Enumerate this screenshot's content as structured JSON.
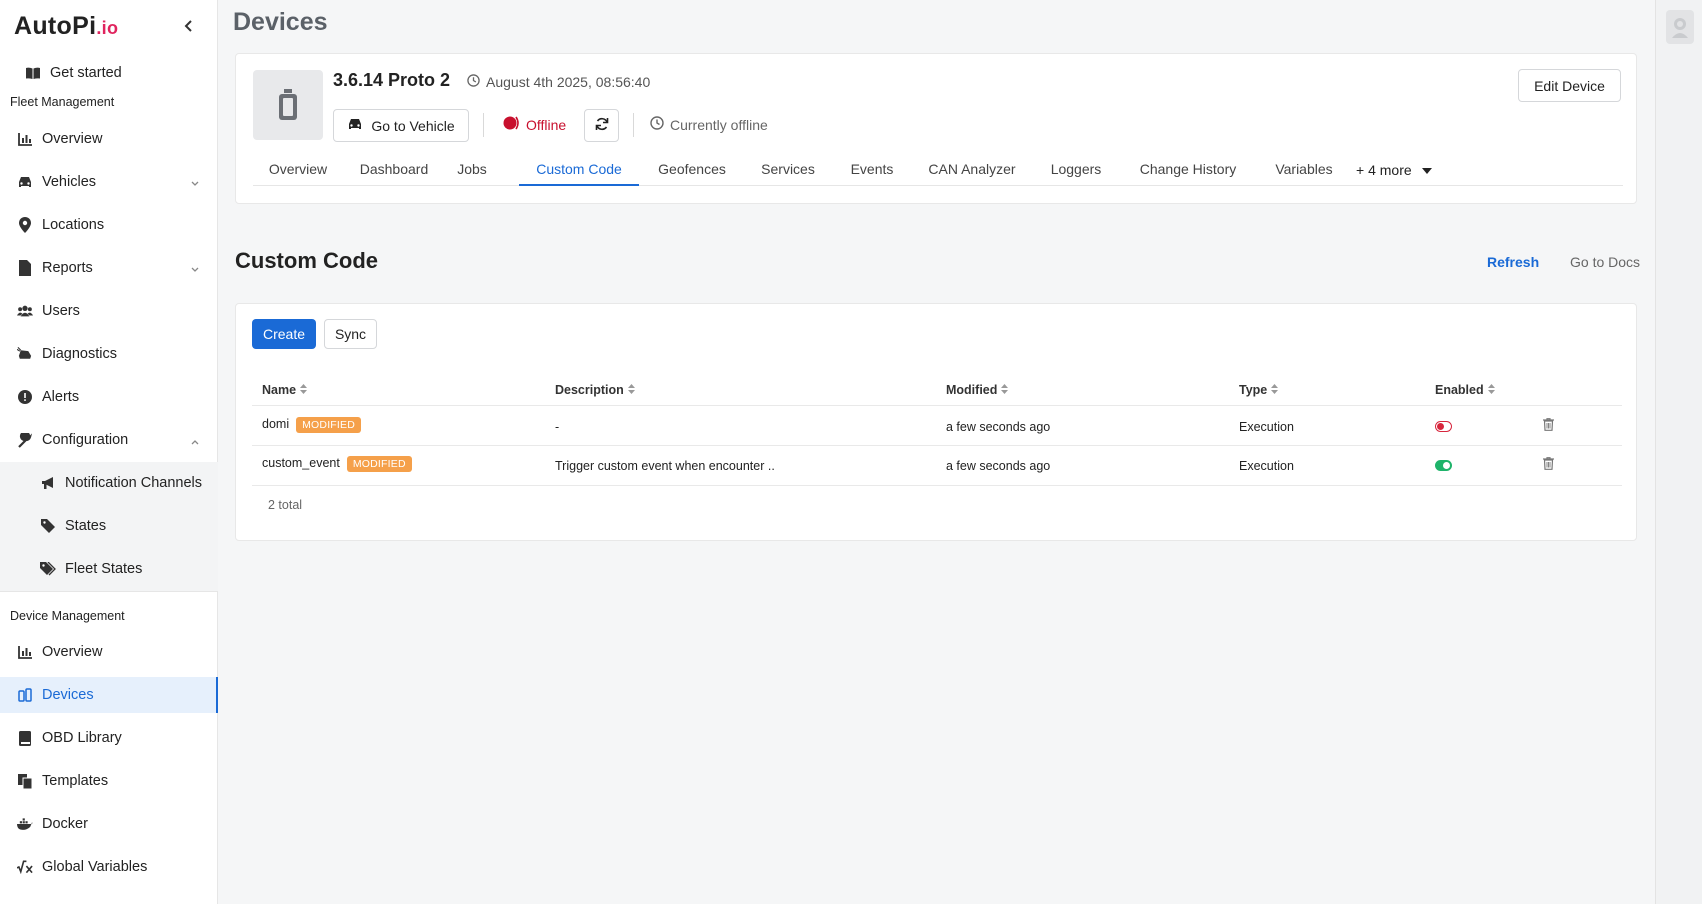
{
  "brand": {
    "logo_main": "AutoPi",
    "logo_suffix": ".io"
  },
  "sidebar": {
    "get_started": "Get started",
    "fleet_section": "Fleet Management",
    "fleet_items": {
      "overview": "Overview",
      "vehicles": "Vehicles",
      "locations": "Locations",
      "reports": "Reports",
      "users": "Users",
      "diagnostics": "Diagnostics",
      "alerts": "Alerts",
      "configuration": "Configuration",
      "notification_channels": "Notification Channels",
      "states": "States",
      "fleet_states": "Fleet States"
    },
    "device_section": "Device Management",
    "device_items": {
      "overview": "Overview",
      "devices": "Devices",
      "obd_library": "OBD Library",
      "templates": "Templates",
      "docker": "Docker",
      "global_variables": "Global Variables"
    }
  },
  "page": {
    "title": "Devices"
  },
  "device": {
    "name": "3.6.14 Proto 2",
    "timestamp": "August 4th 2025, 08:56:40",
    "go_to_vehicle": "Go to Vehicle",
    "status": "Offline",
    "connection": "Currently offline",
    "edit_button": "Edit Device"
  },
  "tabs": {
    "overview": "Overview",
    "dashboard": "Dashboard",
    "jobs": "Jobs",
    "custom_code": "Custom Code",
    "geofences": "Geofences",
    "services": "Services",
    "events": "Events",
    "can_analyzer": "CAN Analyzer",
    "loggers": "Loggers",
    "change_history": "Change History",
    "variables": "Variables",
    "more": "+ 4 more"
  },
  "custom_code": {
    "title": "Custom Code",
    "refresh": "Refresh",
    "docs": "Go to Docs",
    "create": "Create",
    "sync": "Sync",
    "columns": {
      "name": "Name",
      "description": "Description",
      "modified": "Modified",
      "type": "Type",
      "enabled": "Enabled"
    },
    "rows": [
      {
        "name": "domi",
        "badge": "MODIFIED",
        "description": "-",
        "modified": "a few seconds ago",
        "type": "Execution",
        "enabled": false
      },
      {
        "name": "custom_event",
        "badge": "MODIFIED",
        "description": "Trigger custom event when encounter ..",
        "modified": "a few seconds ago",
        "type": "Execution",
        "enabled": true
      }
    ],
    "total": "2 total"
  },
  "colors": {
    "accent": "#1a6ad6",
    "offline": "#c8102e",
    "badge": "#f5a04a",
    "toggle_on": "#1fb36a",
    "toggle_off": "#d7263d"
  }
}
